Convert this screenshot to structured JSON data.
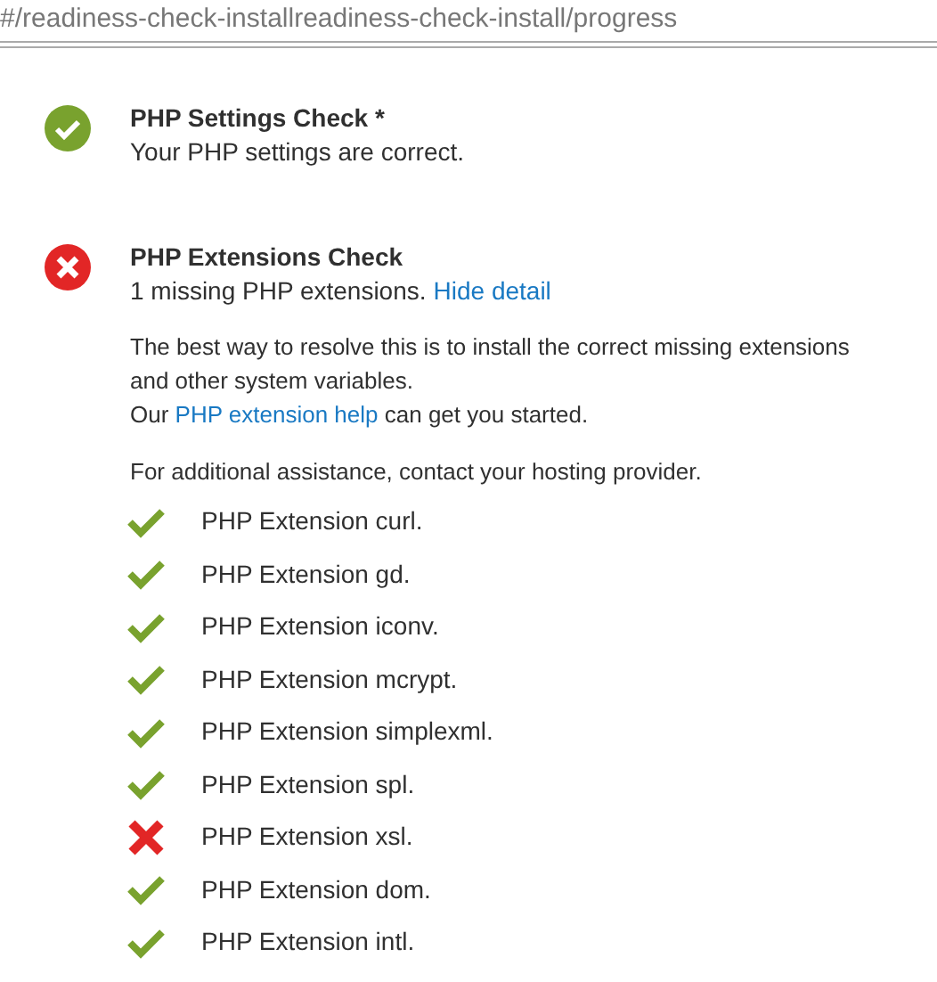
{
  "address_bar": {
    "url": "#/readiness-check-installreadiness-check-install/progress"
  },
  "checks": [
    {
      "title": "PHP Settings Check *",
      "passed": true,
      "message": "Your PHP settings are correct."
    },
    {
      "title": "PHP Extensions Check",
      "passed": false,
      "message": "1 missing PHP extensions.",
      "link": "Hide detail",
      "detail_lines": [
        "The best way to resolve this is to install the correct missing extensions",
        "and other system variables."
      ],
      "help_before": "Our",
      "help_link": "PHP extension help",
      "help_after": "can get you started.",
      "assistance": "For additional assistance, contact your hosting provider.",
      "extensions": [
        {
          "label": "PHP Extension curl.",
          "installed": true
        },
        {
          "label": "PHP Extension gd.",
          "installed": true
        },
        {
          "label": "PHP Extension iconv.",
          "installed": true
        },
        {
          "label": "PHP Extension mcrypt.",
          "installed": true
        },
        {
          "label": "PHP Extension simplexml.",
          "installed": true
        },
        {
          "label": "PHP Extension spl.",
          "installed": true
        },
        {
          "label": "PHP Extension xsl.",
          "installed": false
        },
        {
          "label": "PHP Extension dom.",
          "installed": true
        },
        {
          "label": "PHP Extension intl.",
          "installed": true
        }
      ]
    }
  ]
}
